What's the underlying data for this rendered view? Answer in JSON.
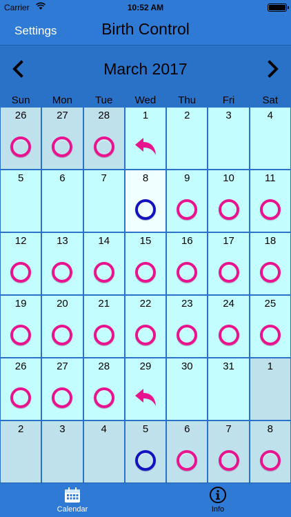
{
  "status": {
    "carrier": "Carrier",
    "time": "10:52 AM"
  },
  "nav": {
    "settings": "Settings",
    "title": "Birth Control"
  },
  "header": {
    "month": "March 2017"
  },
  "weekdays": [
    "Sun",
    "Mon",
    "Tue",
    "Wed",
    "Thu",
    "Fri",
    "Sat"
  ],
  "colors": {
    "pink_ring": "#e8138f",
    "blue_ring": "#1212c0",
    "arrow_icon": "#e8138f",
    "cell": "#c4fdfd",
    "cell_other_month": "#bfe1ec",
    "today": "#f0ffff",
    "background": "#2a72c8"
  },
  "days": [
    {
      "d": "26",
      "s": "out",
      "i": "pink"
    },
    {
      "d": "27",
      "s": "out",
      "i": "pink"
    },
    {
      "d": "28",
      "s": "out",
      "i": "pink"
    },
    {
      "d": "1",
      "s": "in",
      "i": "arrow"
    },
    {
      "d": "2",
      "s": "in",
      "i": ""
    },
    {
      "d": "3",
      "s": "in",
      "i": ""
    },
    {
      "d": "4",
      "s": "in",
      "i": ""
    },
    {
      "d": "5",
      "s": "in",
      "i": ""
    },
    {
      "d": "6",
      "s": "in",
      "i": ""
    },
    {
      "d": "7",
      "s": "in",
      "i": ""
    },
    {
      "d": "8",
      "s": "today",
      "i": "blue"
    },
    {
      "d": "9",
      "s": "in",
      "i": "pink"
    },
    {
      "d": "10",
      "s": "in",
      "i": "pink"
    },
    {
      "d": "11",
      "s": "in",
      "i": "pink"
    },
    {
      "d": "12",
      "s": "in",
      "i": "pink"
    },
    {
      "d": "13",
      "s": "in",
      "i": "pink"
    },
    {
      "d": "14",
      "s": "in",
      "i": "pink"
    },
    {
      "d": "15",
      "s": "in",
      "i": "pink"
    },
    {
      "d": "16",
      "s": "in",
      "i": "pink"
    },
    {
      "d": "17",
      "s": "in",
      "i": "pink"
    },
    {
      "d": "18",
      "s": "in",
      "i": "pink"
    },
    {
      "d": "19",
      "s": "in",
      "i": "pink"
    },
    {
      "d": "20",
      "s": "in",
      "i": "pink"
    },
    {
      "d": "21",
      "s": "in",
      "i": "pink"
    },
    {
      "d": "22",
      "s": "in",
      "i": "pink"
    },
    {
      "d": "23",
      "s": "in",
      "i": "pink"
    },
    {
      "d": "24",
      "s": "in",
      "i": "pink"
    },
    {
      "d": "25",
      "s": "in",
      "i": "pink"
    },
    {
      "d": "26",
      "s": "in",
      "i": "pink"
    },
    {
      "d": "27",
      "s": "in",
      "i": "pink"
    },
    {
      "d": "28",
      "s": "in",
      "i": "pink"
    },
    {
      "d": "29",
      "s": "in",
      "i": "arrow"
    },
    {
      "d": "30",
      "s": "in",
      "i": ""
    },
    {
      "d": "31",
      "s": "in",
      "i": ""
    },
    {
      "d": "1",
      "s": "out",
      "i": ""
    },
    {
      "d": "2",
      "s": "out",
      "i": ""
    },
    {
      "d": "3",
      "s": "out",
      "i": ""
    },
    {
      "d": "4",
      "s": "out",
      "i": ""
    },
    {
      "d": "5",
      "s": "out",
      "i": "blue"
    },
    {
      "d": "6",
      "s": "out",
      "i": "pink"
    },
    {
      "d": "7",
      "s": "out",
      "i": "pink"
    },
    {
      "d": "8",
      "s": "out",
      "i": "pink"
    }
  ],
  "tabs": {
    "calendar": "Calendar",
    "info": "Info"
  }
}
